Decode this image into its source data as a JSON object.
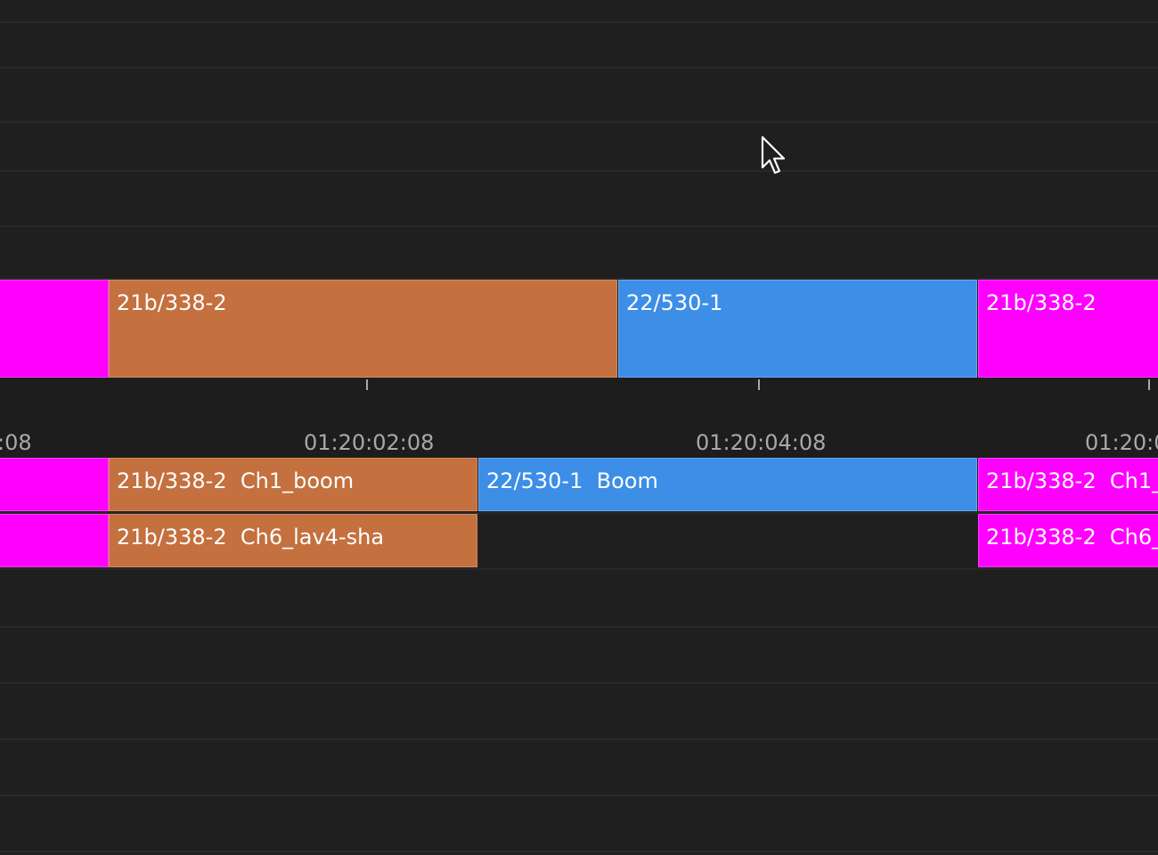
{
  "video_track": {
    "clips": [
      {
        "label": "",
        "color": "#ff00ff"
      },
      {
        "label": "21b/338-2",
        "color": "#c4703f"
      },
      {
        "label": "22/530-1",
        "color": "#3c8ee6"
      },
      {
        "label": "21b/338-2",
        "color": "#ff00ff"
      }
    ]
  },
  "ruler": {
    "timecodes": [
      ":08",
      "01:20:02:08",
      "01:20:04:08",
      "01:20:0"
    ]
  },
  "audio_track_1": {
    "clips": [
      {
        "label": "",
        "color": "#ff00ff"
      },
      {
        "label": "21b/338-2  Ch1_boom",
        "color": "#c4703f"
      },
      {
        "label": "22/530-1  Boom",
        "color": "#3c8ee6"
      },
      {
        "label": "21b/338-2  Ch1_",
        "color": "#ff00ff"
      }
    ]
  },
  "audio_track_2": {
    "clips": [
      {
        "label": "",
        "color": "#ff00ff"
      },
      {
        "label": "21b/338-2  Ch6_lav4-sha",
        "color": "#c4703f"
      },
      {
        "label": "21b/338-2  Ch6_",
        "color": "#ff00ff"
      }
    ]
  },
  "cursor": {
    "icon": "mouse-pointer-icon"
  }
}
